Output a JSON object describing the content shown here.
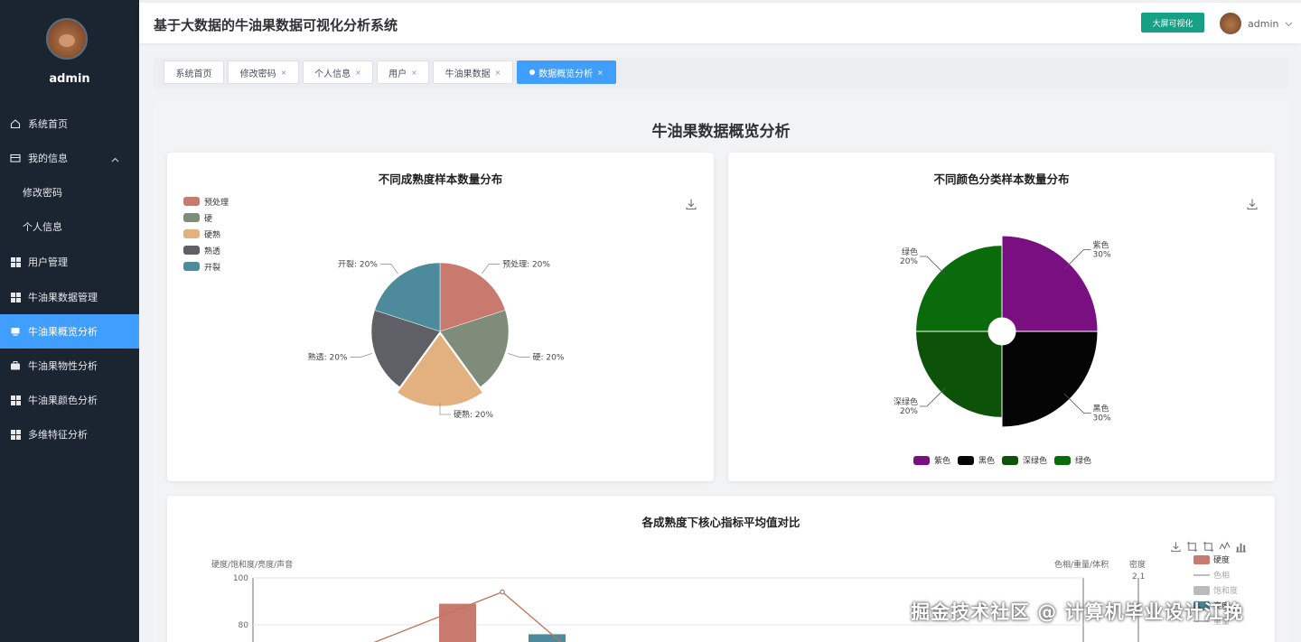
{
  "sidebar": {
    "username": "admin",
    "menu": [
      {
        "label": "系统首页"
      },
      {
        "label": "我的信息"
      },
      {
        "label": "修改密码"
      },
      {
        "label": "个人信息"
      },
      {
        "label": "用户管理"
      },
      {
        "label": "牛油果数据管理"
      },
      {
        "label": "牛油果概览分析"
      },
      {
        "label": "牛油果物性分析"
      },
      {
        "label": "牛油果颜色分析"
      },
      {
        "label": "多维特征分析"
      }
    ]
  },
  "header": {
    "title": "基于大数据的牛油果数据可视化分析系统",
    "bigscreen_label": "大屏可视化",
    "user_label": "admin"
  },
  "tabs": [
    {
      "label": "系统首页",
      "active": false
    },
    {
      "label": "修改密码",
      "active": false
    },
    {
      "label": "个人信息",
      "active": false
    },
    {
      "label": "用户",
      "active": false
    },
    {
      "label": "牛油果数据",
      "active": false
    },
    {
      "label": "数据概览分析",
      "active": true
    }
  ],
  "page": {
    "title": "牛油果数据概览分析"
  },
  "chart_data": [
    {
      "type": "pie",
      "title": "不同成熟度样本数量分布",
      "legend": [
        "预处理",
        "硬",
        "硬熟",
        "熟透",
        "开裂"
      ],
      "slices": [
        {
          "name": "预处理",
          "value": 20,
          "label": "预处理: 20%",
          "color": "#c97a6e"
        },
        {
          "name": "硬",
          "value": 20,
          "label": "硬: 20%",
          "color": "#7f8c7a"
        },
        {
          "name": "硬熟",
          "value": 20,
          "label": "硬熟: 20%",
          "color": "#e3b07f"
        },
        {
          "name": "熟透",
          "value": 20,
          "label": "熟透: 20%",
          "color": "#5e6066"
        },
        {
          "name": "开裂",
          "value": 20,
          "label": "开裂: 20%",
          "color": "#4d8a9b"
        }
      ]
    },
    {
      "type": "pie",
      "subtype": "rose",
      "title": "不同颜色分类样本数量分布",
      "legend": [
        "紫色",
        "黑色",
        "深绿色",
        "绿色"
      ],
      "slices": [
        {
          "name": "紫色",
          "value": 30,
          "pct": "30%",
          "color": "#7a0f82"
        },
        {
          "name": "黑色",
          "value": 30,
          "pct": "30%",
          "color": "#050505"
        },
        {
          "name": "深绿色",
          "value": 20,
          "pct": "20%",
          "color": "#0c5208"
        },
        {
          "name": "绿色",
          "value": 20,
          "pct": "20%",
          "color": "#0a6b0a"
        }
      ]
    },
    {
      "type": "bar",
      "title": "各成熟度下核心指标平均值对比",
      "y_left_label": "硬度/饱和度/亮度/声音",
      "y_right_label": "色相/重量/体积",
      "y_right2_label": "密度",
      "y_ticks_visible": [
        "100",
        "80"
      ],
      "y_right2_tick_visible": "2.1",
      "ylim": [
        0,
        100
      ],
      "legend": [
        {
          "name": "硬度",
          "color": "#c97a6e"
        },
        {
          "name": "色相",
          "color": "#bbbbbb"
        },
        {
          "name": "饱和度",
          "color": "#bbbbbb"
        },
        {
          "name": "亮度",
          "color": "#4d8a9b"
        },
        {
          "name": "重量",
          "color": "#bbbbbb"
        }
      ],
      "visible_marks": {
        "bar_hardness_peak": 89,
        "bar_teal_peak": 76,
        "line_peak": 94
      }
    }
  ],
  "watermark": "掘金技术社区 @ 计算机毕业设计江挽"
}
